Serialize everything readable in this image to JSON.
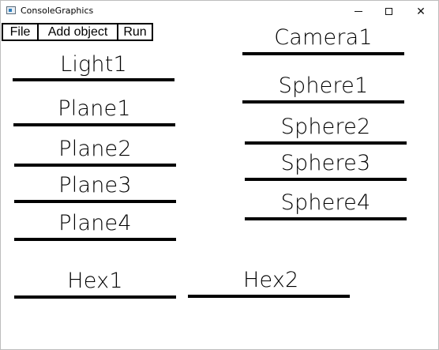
{
  "window": {
    "title": "ConsoleGraphics",
    "caption_buttons": {
      "minimize": "—",
      "maximize": "□",
      "close": "✕"
    }
  },
  "menu": {
    "file": "File",
    "add_object": "Add object",
    "run": "Run"
  },
  "objects": {
    "light1": "Light1",
    "plane1": "Plane1",
    "plane2": "Plane2",
    "plane3": "Plane3",
    "plane4": "Plane4",
    "hex1": "Hex1",
    "hex2": "Hex2",
    "camera1": "Camera1",
    "sphere1": "Sphere1",
    "sphere2": "Sphere2",
    "sphere3": "Sphere3",
    "sphere4": "Sphere4"
  }
}
